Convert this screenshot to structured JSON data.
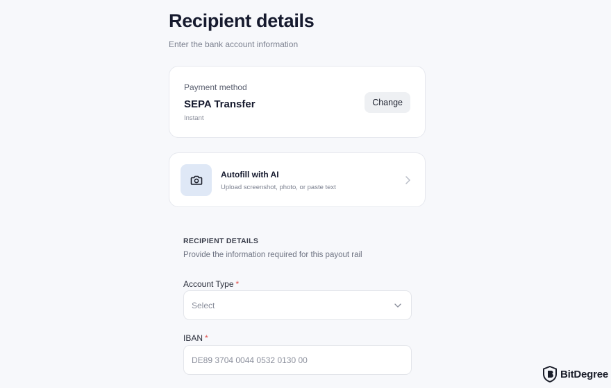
{
  "header": {
    "title": "Recipient details",
    "subtitle": "Enter the bank account information"
  },
  "payment_method": {
    "label": "Payment method",
    "name": "SEPA Transfer",
    "speed": "Instant",
    "change_label": "Change"
  },
  "autofill": {
    "title": "Autofill with AI",
    "subtitle": "Upload screenshot, photo, or paste text",
    "icon": "camera-icon"
  },
  "recipient_section": {
    "heading": "RECIPIENT DETAILS",
    "subtitle": "Provide the information required for this payout rail"
  },
  "fields": {
    "account_type": {
      "label": "Account Type",
      "required_mark": "*",
      "value": "Select"
    },
    "iban": {
      "label": "IBAN",
      "required_mark": "*",
      "placeholder": "DE89 3704 0044 0532 0130 00"
    }
  },
  "watermark": {
    "text": "BitDegree"
  },
  "colors": {
    "background": "#f7f8fb",
    "required": "#e0524f",
    "icon_tile": "#dfe8f6"
  }
}
